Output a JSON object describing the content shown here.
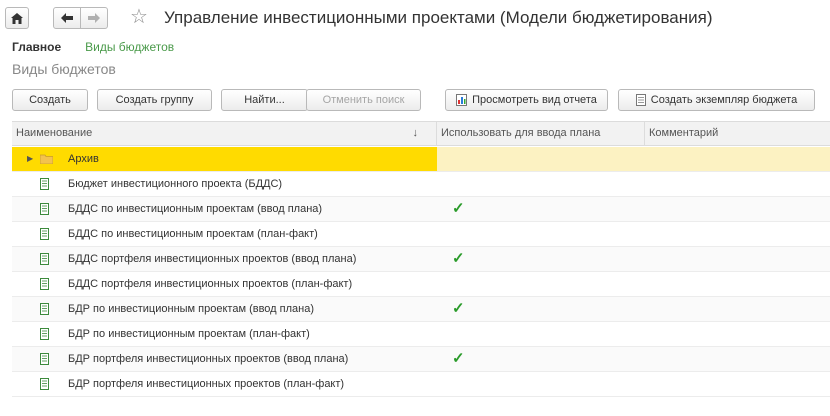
{
  "header": {
    "title": "Управление инвестиционными проектами (Модели бюджетирования)"
  },
  "nav": {
    "main": "Главное",
    "link": "Виды бюджетов"
  },
  "section_title": "Виды бюджетов",
  "toolbar": {
    "create": "Создать",
    "create_group": "Создать группу",
    "find": "Найти...",
    "cancel_search": "Отменить поиск",
    "view_report": "Просмотреть вид отчета",
    "create_instance": "Создать экземпляр бюджета"
  },
  "table": {
    "columns": {
      "name": "Наименование",
      "use_for_plan": "Использовать для ввода плана",
      "comment": "Комментарий"
    },
    "sort_indicator": "↓",
    "rows": [
      {
        "name": "Архив",
        "type": "folder",
        "plan": ""
      },
      {
        "name": "Бюджет инвестиционного проекта (БДДС)",
        "type": "doc",
        "plan": ""
      },
      {
        "name": "БДДС по инвестиционным проектам (ввод плана)",
        "type": "doc",
        "plan": "✓"
      },
      {
        "name": "БДДС по инвестиционным проектам (план-факт)",
        "type": "doc",
        "plan": ""
      },
      {
        "name": "БДДС портфеля инвестиционных проектов (ввод плана)",
        "type": "doc",
        "plan": "✓"
      },
      {
        "name": "БДДС портфеля инвестиционных проектов (план-факт)",
        "type": "doc",
        "plan": ""
      },
      {
        "name": "БДР по инвестиционным проектам (ввод плана)",
        "type": "doc",
        "plan": "✓"
      },
      {
        "name": "БДР по инвестиционным проектам (план-факт)",
        "type": "doc",
        "plan": ""
      },
      {
        "name": "БДР портфеля инвестиционных проектов (ввод плана)",
        "type": "doc",
        "plan": "✓"
      },
      {
        "name": "БДР портфеля инвестиционных проектов (план-факт)",
        "type": "doc",
        "plan": ""
      }
    ]
  },
  "colors": {
    "selected_row": "#ffdb00",
    "check": "#2a9b2a",
    "link": "#4a9a4a"
  }
}
